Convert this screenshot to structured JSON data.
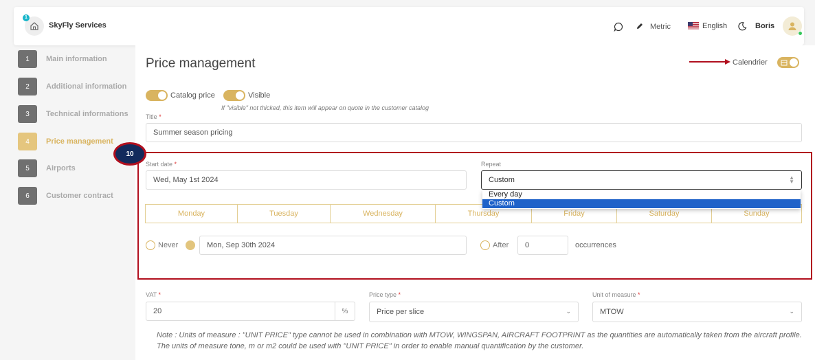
{
  "header": {
    "home_badge": "1",
    "app_name": "SkyFly Services",
    "metric_label": "Metric",
    "language": "English",
    "user": "Boris"
  },
  "sidebar": {
    "items": [
      {
        "num": "1",
        "label": "Main information"
      },
      {
        "num": "2",
        "label": "Additional information"
      },
      {
        "num": "3",
        "label": "Technical informations"
      },
      {
        "num": "4",
        "label": "Price management"
      },
      {
        "num": "5",
        "label": "Airports"
      },
      {
        "num": "6",
        "label": "Customer contract"
      }
    ]
  },
  "main": {
    "title": "Price management",
    "calendar_label": "Calendrier",
    "catalog_price_label": "Catalog price",
    "visible_label": "Visible",
    "visible_hint": "If \"visible\" not thicked, this item will appear on quote in the customer catalog",
    "title_field": {
      "label": "Title",
      "required": "*",
      "value": "Summer season pricing"
    },
    "step_badge": "10",
    "start_date": {
      "label": "Start date",
      "required": "*",
      "value": "Wed, May 1st 2024"
    },
    "repeat": {
      "label": "Repeat",
      "value": "Custom",
      "options": [
        "Every day",
        "Custom"
      ]
    },
    "days": [
      "Monday",
      "Tuesday",
      "Wednesday",
      "Thursday",
      "Friday",
      "Saturday",
      "Sunday"
    ],
    "end": {
      "never_label": "Never",
      "end_date": "Mon, Sep 30th 2024",
      "after_label": "After",
      "occurrences_value": "0",
      "occurrences_label": "occurrences"
    },
    "vat": {
      "label": "VAT",
      "required": "*",
      "value": "20",
      "suffix": "%"
    },
    "price_type": {
      "label": "Price type",
      "required": "*",
      "value": "Price per slice"
    },
    "unit": {
      "label": "Unit of measure",
      "required": "*",
      "value": "MTOW"
    },
    "note": "Note : Units of measure : \"UNIT PRICE\" type cannot be used in combination with MTOW, WINGSPAN, AIRCRAFT FOOTPRINT as the quantities are automatically taken from the aircraft profile. The units of measure tone, m or m2 could be used with \"UNIT PRICE\" in order to enable manual quantification by the customer."
  },
  "colors": {
    "accent": "#d9b460",
    "highlight": "#b10f1e",
    "badge": "#122a5c",
    "selected_option": "#1f62c9"
  }
}
